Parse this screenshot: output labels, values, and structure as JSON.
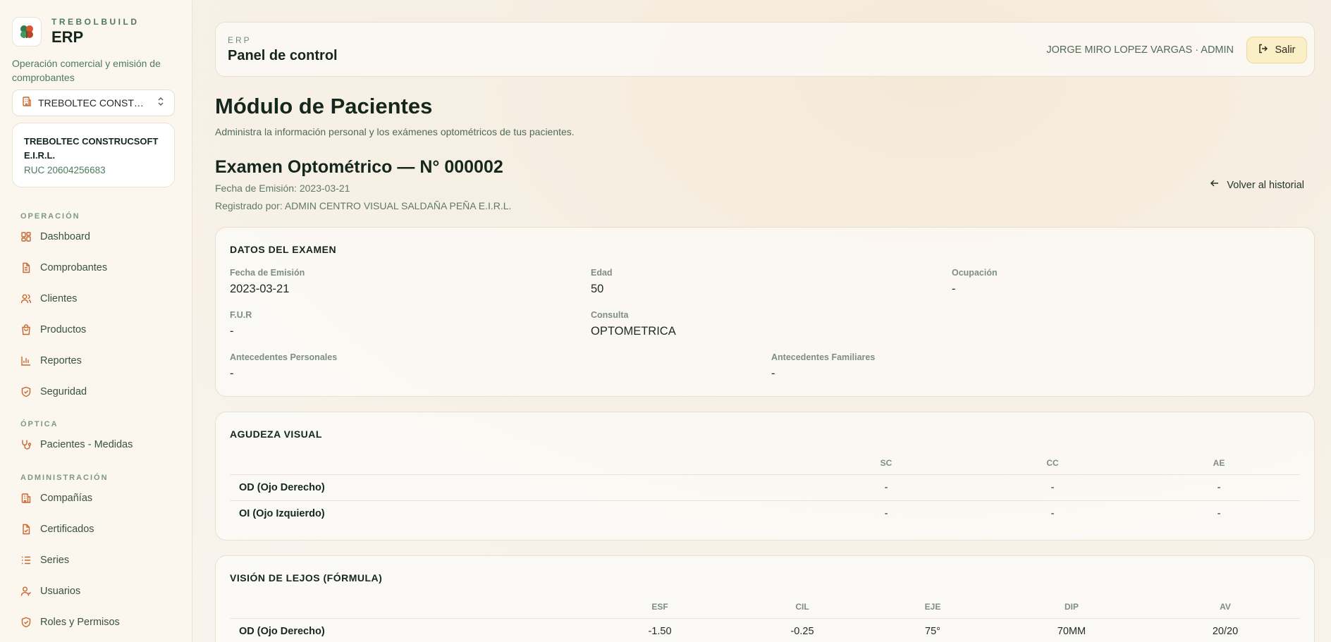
{
  "brand": {
    "eyebrow": "TREBOLBUILD",
    "title": "ERP",
    "subtitle": "Operación comercial y emisión de comprobantes"
  },
  "company_selector": {
    "value": "TREBOLTEC CONSTRUCSOFT E.I.R.L.",
    "display": "TREBOLTEC CONST…"
  },
  "company_card": {
    "name": "TREBOLTEC CONSTRUCSOFT E.I.R.L.",
    "ruc": "RUC 20604256683"
  },
  "nav": {
    "section_operacion": "OPERACIÓN",
    "section_optica": "ÓPTICA",
    "section_admin": "ADMINISTRACIÓN",
    "items": [
      {
        "label": "Dashboard",
        "icon": "dashboard-icon"
      },
      {
        "label": "Comprobantes",
        "icon": "document-icon"
      },
      {
        "label": "Clientes",
        "icon": "users-icon"
      },
      {
        "label": "Productos",
        "icon": "bag-icon"
      },
      {
        "label": "Reportes",
        "icon": "chart-icon"
      },
      {
        "label": "Seguridad",
        "icon": "shield-icon"
      },
      {
        "label": "Pacientes - Medidas",
        "icon": "stethoscope-icon"
      },
      {
        "label": "Compañías",
        "icon": "building-icon"
      },
      {
        "label": "Certificados",
        "icon": "certificate-icon"
      },
      {
        "label": "Series",
        "icon": "list-icon"
      },
      {
        "label": "Usuarios",
        "icon": "user-icon"
      },
      {
        "label": "Roles y Permisos",
        "icon": "shield-check-icon"
      }
    ]
  },
  "topbar": {
    "eyebrow": "ERP",
    "title": "Panel de control",
    "user": "JORGE MIRO LOPEZ VARGAS · ADMIN",
    "logout_label": "Salir"
  },
  "page": {
    "title": "Módulo de Pacientes",
    "subtitle": "Administra la información personal y los exámenes optométricos de tus pacientes."
  },
  "exam": {
    "title": "Examen Optométrico — N° 000002",
    "fecha_line": "Fecha de Emisión: 2023-03-21",
    "registrado_line": "Registrado por: ADMIN CENTRO VISUAL SALDAÑA PEÑA E.I.R.L.",
    "back_label": "Volver al historial"
  },
  "datos": {
    "title": "DATOS DEL EXAMEN",
    "fields": [
      {
        "label": "Fecha de Emisión",
        "value": "2023-03-21"
      },
      {
        "label": "Edad",
        "value": "50"
      },
      {
        "label": "Ocupación",
        "value": "-"
      },
      {
        "label": "F.U.R",
        "value": "-"
      },
      {
        "label": "Consulta",
        "value": "OPTOMETRICA"
      },
      {
        "label": "Antecedentes Personales",
        "value": "-"
      },
      {
        "label": "Antecedentes Familiares",
        "value": "-"
      }
    ]
  },
  "agudeza": {
    "title": "AGUDEZA VISUAL",
    "columns": [
      "SC",
      "CC",
      "AE"
    ],
    "rows": [
      {
        "label": "OD (Ojo Derecho)",
        "values": [
          "-",
          "-",
          "-"
        ]
      },
      {
        "label": "OI (Ojo Izquierdo)",
        "values": [
          "-",
          "-",
          "-"
        ]
      }
    ]
  },
  "lejos": {
    "title": "VISIÓN DE LEJOS (FÓRMULA)",
    "columns": [
      "ESF",
      "CIL",
      "EJE",
      "DIP",
      "AV"
    ],
    "rows": [
      {
        "label": "OD (Ojo Derecho)",
        "values": [
          "-1.50",
          "-0.25",
          "75°",
          "70MM",
          "20/20"
        ]
      }
    ]
  },
  "colors": {
    "accent": "#c8662f",
    "brand_green": "#4f7a5e",
    "logout_bg": "#fbefc7"
  }
}
